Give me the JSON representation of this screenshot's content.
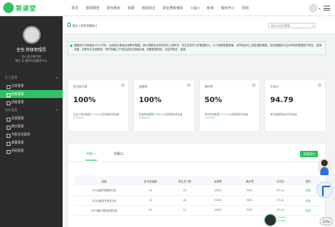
{
  "header": {
    "logo_text": "第课堂",
    "nav": [
      "首页",
      "营商课堂",
      "综合服务",
      "党建",
      "校园安全",
      "职业教育服务",
      "公益",
      "新闻",
      "服务中心",
      "帮助"
    ],
    "nav_dropdown_index": 6
  },
  "sidebar": {
    "name": "全省 校级管理员",
    "sub_lines": [
      "四川省中等学校",
      "物业 及 服务外包服务中心"
    ],
    "groups": [
      {
        "label": "学习管理",
        "items": [
          "总体管理",
          "校级管理"
        ]
      },
      {
        "label": "",
        "items": [
          "班级管理"
        ]
      },
      {
        "label": "综合管理",
        "items": [
          "资源管理"
        ]
      },
      {
        "label": "",
        "items": [
          "教学管理",
          "专题活动管理",
          "赛事管理"
        ]
      },
      {
        "label": "",
        "items": [
          "系统管理"
        ]
      }
    ],
    "active_item": "校级管理"
  },
  "breadcrumb": "首页 / 学年学期统计",
  "year_select": "2021-2022学年",
  "notice": "数据统计时间截至2021学年。全部统计覆盖全部教学数据。统计数据来自学校实际上报情况、学生完成学习的数据统计；为了保障数据准确，请学校及时上报及更新数据；优化数据统计后对学校的数据进行修正，如有问题，请联系平台管理员；同时请确认下列信息是否准确无误，如果数据有误，请及时联系，谢谢。",
  "cards": [
    {
      "label": "学生参与率",
      "value": "100%",
      "desc_prefix": "已进入学生数量",
      "desc_highlight": "3,7741",
      "desc_suffix": "人/实际报名学生数",
      "desc_line2_highlight": "3,7741人"
    },
    {
      "label": "及格率",
      "value": "100%",
      "desc_prefix": "及格学生数量",
      "desc_highlight": "3,3001",
      "desc_suffix": "人/实际报名学生数",
      "desc_line2_highlight": "3,3001人"
    },
    {
      "label": "满分率",
      "value": "50%",
      "desc_prefix": "满分学生数量",
      "desc_highlight": "3,1771",
      "desc_suffix": "人/实际报名学生数",
      "desc_line2_highlight": "3,1771人"
    },
    {
      "label": "平均分",
      "value": "94.79",
      "desc_prefix": "参与答题学生的平均成绩",
      "desc_highlight": "",
      "desc_suffix": "",
      "desc_line2_highlight": ""
    }
  ],
  "tabs": [
    "中职一",
    "中职二"
  ],
  "active_tab": 0,
  "export_label": "批量导出",
  "table": {
    "headers": [
      "班级",
      "参与班级数",
      "学生总人数",
      "及格率",
      "满分率",
      "平均分",
      "操作"
    ],
    "rows": [
      [
        "2018级学前教育1班",
        "54",
        "54",
        "100%",
        "54%",
        "97.41",
        "查看"
      ],
      [
        "2019级电子商务1班",
        "42",
        "42",
        "100%",
        "50%",
        "97.41",
        "查看"
      ],
      [
        "2019级计算机应用1班",
        "51",
        "51",
        "100%",
        "50%",
        "97.41",
        "查看"
      ]
    ]
  },
  "widgets": {
    "speed_value": "74",
    "speed_lines": [
      "0.1K/s",
      "0.3K/s"
    ],
    "percent_badge": "53%"
  }
}
